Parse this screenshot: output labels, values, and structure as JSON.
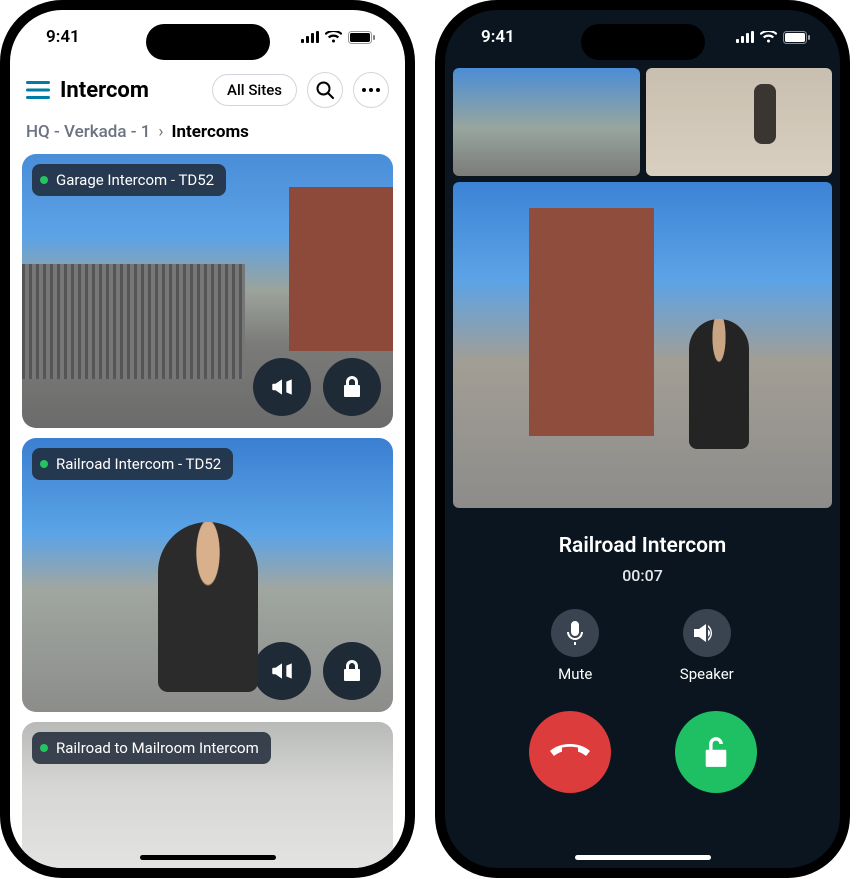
{
  "status": {
    "time": "9:41"
  },
  "left": {
    "title": "Intercom",
    "filter_label": "All Sites",
    "breadcrumb_path": "HQ - Verkada - 1",
    "breadcrumb_current": "Intercoms",
    "cards": [
      {
        "label": "Garage Intercom - TD52"
      },
      {
        "label": "Railroad Intercom - TD52"
      },
      {
        "label": "Railroad to Mailroom Intercom"
      }
    ]
  },
  "right": {
    "call_title": "Railroad Intercom",
    "call_timer": "00:07",
    "mute_label": "Mute",
    "speaker_label": "Speaker"
  }
}
